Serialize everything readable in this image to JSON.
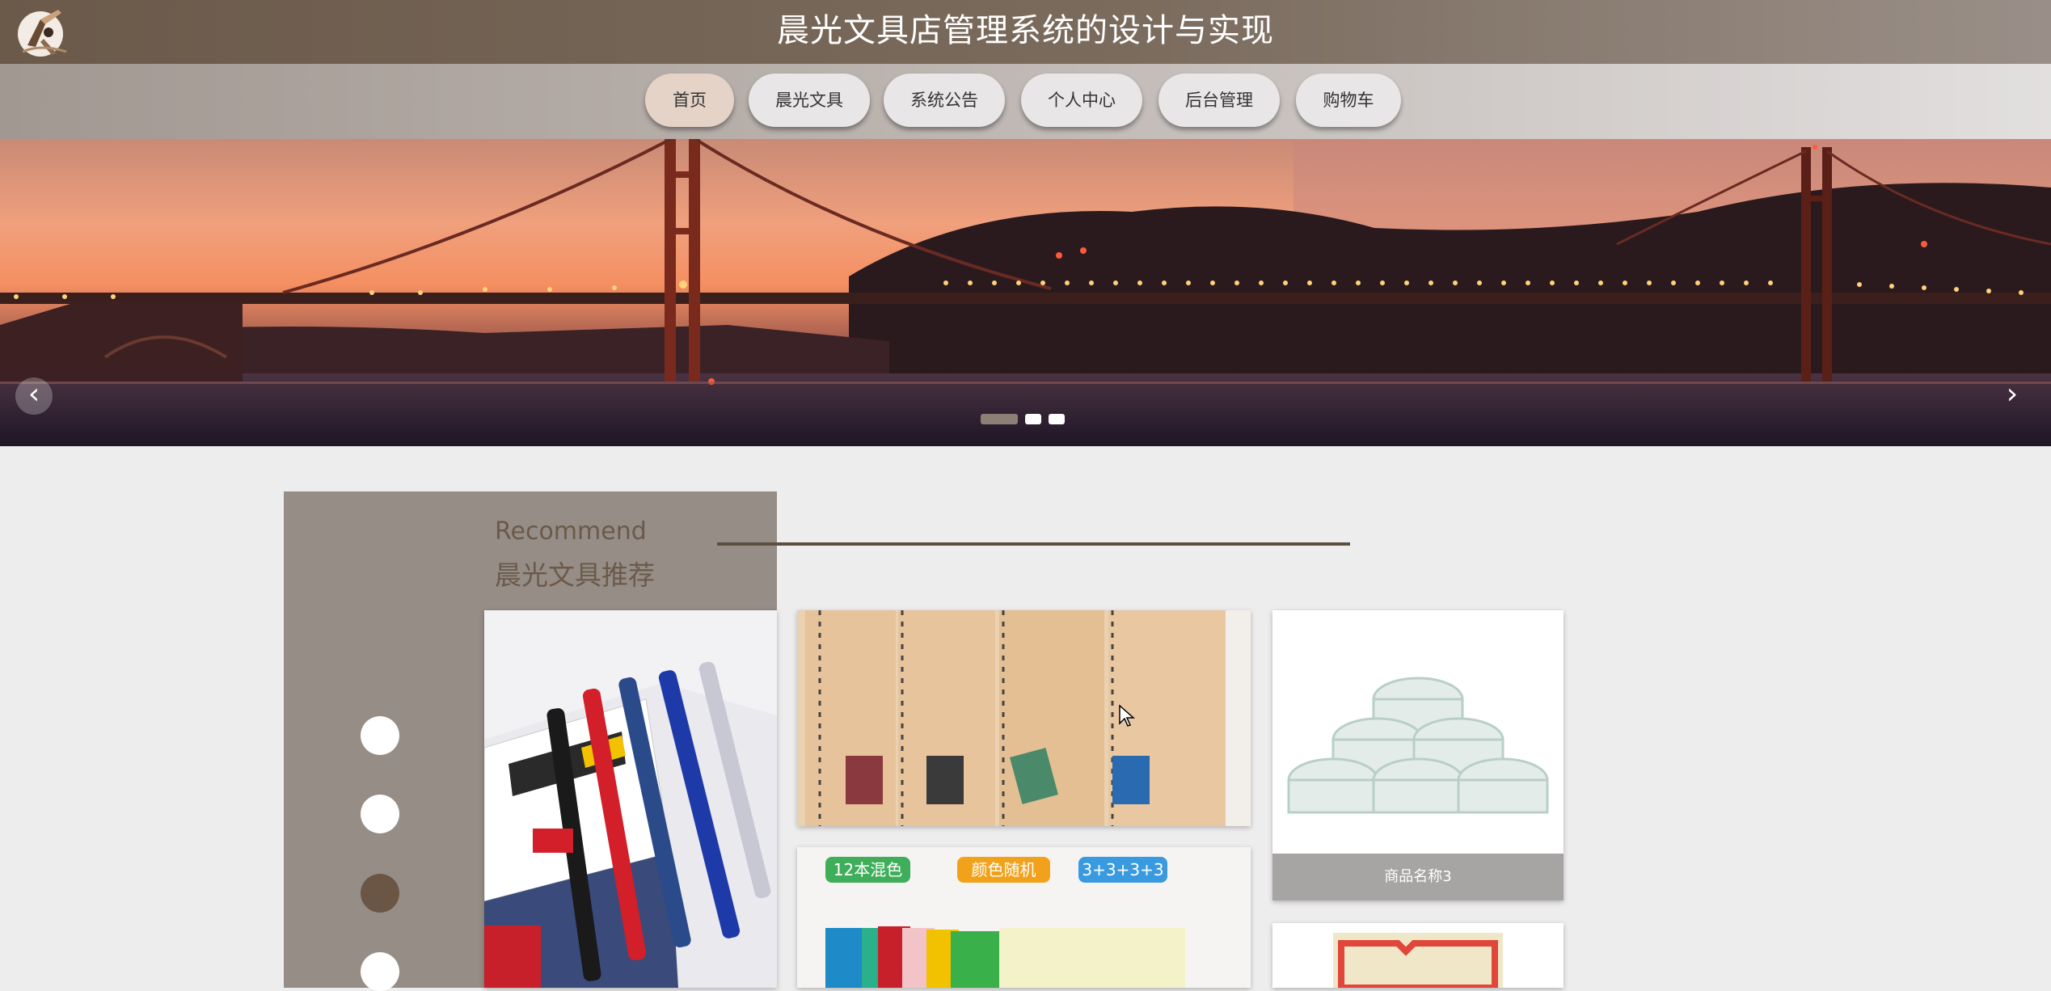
{
  "header": {
    "title": "晨光文具店管理系统的设计与实现",
    "logo_icon": "paintbrush-figure-logo"
  },
  "nav": {
    "items": [
      {
        "label": "首页",
        "active": true
      },
      {
        "label": "晨光文具",
        "active": false
      },
      {
        "label": "系统公告",
        "active": false
      },
      {
        "label": "个人中心",
        "active": false
      },
      {
        "label": "后台管理",
        "active": false
      },
      {
        "label": "购物车",
        "active": false
      }
    ]
  },
  "banner": {
    "prev_icon": "chevron-left-icon",
    "next_icon": "chevron-right-icon",
    "prev_glyph": "‹",
    "next_glyph": "›",
    "slide_count": 3,
    "active_slide": 1
  },
  "recommend": {
    "title_en": "Recommend",
    "title_cn": "晨光文具推荐",
    "selector_count": 4,
    "active_selector": 3,
    "products": [
      {
        "caption": "",
        "image": "gel-pens-box"
      },
      {
        "caption": "",
        "image": "spiral-notebooks"
      },
      {
        "caption": "商品名称3",
        "image": "clear-tape-rolls"
      },
      {
        "caption": "",
        "image": "colored-folders",
        "badges": [
          "12本混色",
          "颜色随机",
          "3+3+3+3"
        ]
      },
      {
        "caption": "",
        "image": "label-stickers"
      }
    ]
  },
  "colors": {
    "accent": "#6b5a4a",
    "panel": "#958d86",
    "nav_active": "#e4d3c6"
  }
}
